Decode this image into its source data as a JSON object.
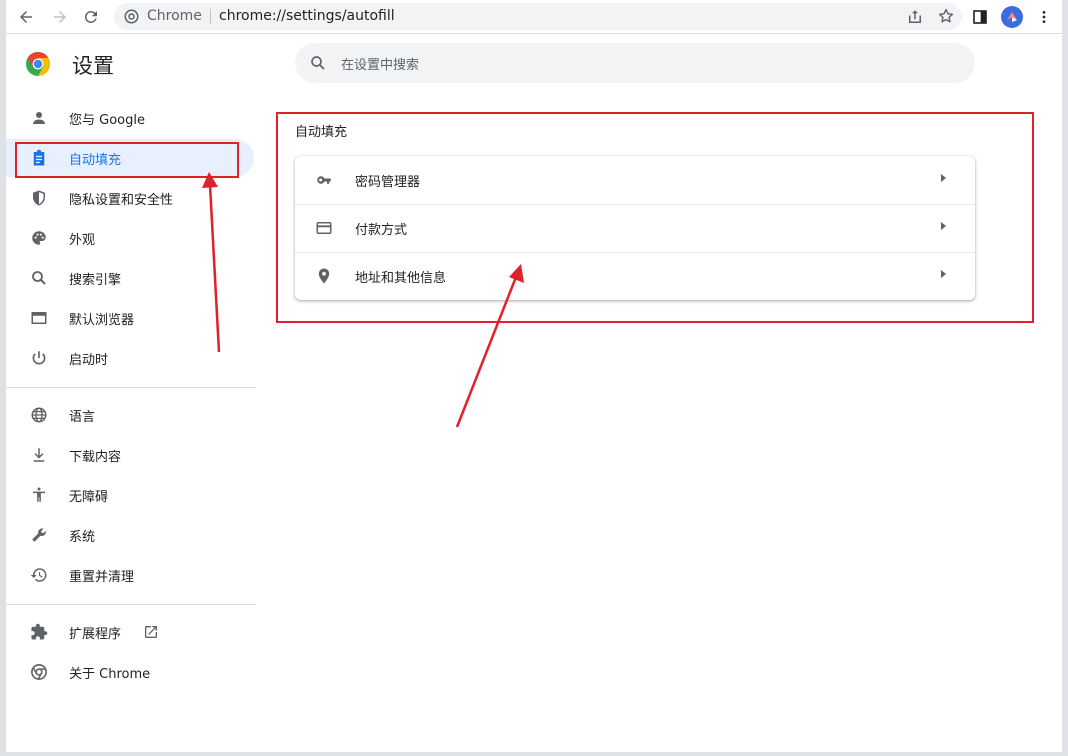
{
  "toolbar": {
    "site_label": "Chrome",
    "url": "chrome://settings/autofill"
  },
  "sidebar": {
    "title": "设置",
    "items": [
      {
        "label": "您与 Google",
        "icon": "person-icon"
      },
      {
        "label": "自动填充",
        "icon": "clipboard-icon",
        "active": true
      },
      {
        "label": "隐私设置和安全性",
        "icon": "shield-icon"
      },
      {
        "label": "外观",
        "icon": "palette-icon"
      },
      {
        "label": "搜索引擎",
        "icon": "search-icon"
      },
      {
        "label": "默认浏览器",
        "icon": "browser-icon"
      },
      {
        "label": "启动时",
        "icon": "power-icon"
      },
      {
        "label": "语言",
        "icon": "globe-icon"
      },
      {
        "label": "下载内容",
        "icon": "download-icon"
      },
      {
        "label": "无障碍",
        "icon": "accessibility-icon"
      },
      {
        "label": "系统",
        "icon": "wrench-icon"
      },
      {
        "label": "重置并清理",
        "icon": "restore-icon"
      },
      {
        "label": "扩展程序",
        "icon": "puzzle-icon"
      },
      {
        "label": "关于 Chrome",
        "icon": "chrome-icon"
      }
    ]
  },
  "search": {
    "placeholder": "在设置中搜索"
  },
  "autofill": {
    "title": "自动填充",
    "rows": [
      {
        "label": "密码管理器",
        "icon": "key-icon"
      },
      {
        "label": "付款方式",
        "icon": "credit-card-icon"
      },
      {
        "label": "地址和其他信息",
        "icon": "location-pin-icon"
      }
    ]
  },
  "colors": {
    "accent": "#1a73e8",
    "annotation": "#e0202a",
    "active_bg": "#e8f0fe"
  }
}
